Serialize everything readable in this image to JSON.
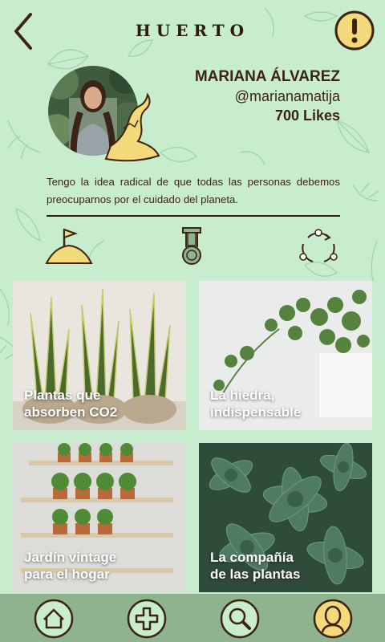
{
  "header": {
    "title": "HUERTO",
    "back_icon": "chevron-left-icon",
    "alert_icon": "exclamation-icon"
  },
  "profile": {
    "name": "MARIANA ÁLVAREZ",
    "handle": "@marianamatija",
    "likes": "700 Likes",
    "bio": "Tengo la idea radical de que todas las personas debemos preocuparnos por el cuidado del planeta."
  },
  "actions": [
    {
      "icon": "flag-mountain-icon"
    },
    {
      "icon": "medal-icon"
    },
    {
      "icon": "recycle-icon"
    }
  ],
  "cards": [
    {
      "label_1": "Plantas que",
      "label_2": "absorben CO2"
    },
    {
      "label_1": "La hiedra,",
      "label_2": "indispensable"
    },
    {
      "label_1": "Jardín vintage",
      "label_2": "para el hogar"
    },
    {
      "label_1": "La compañía",
      "label_2": "de las plantas"
    }
  ],
  "nav": [
    {
      "icon": "home-icon"
    },
    {
      "icon": "plus-icon"
    },
    {
      "icon": "search-icon"
    },
    {
      "icon": "profile-icon"
    }
  ],
  "colors": {
    "background": "#c8ecce",
    "accent": "#f3d97a",
    "text": "#3b2410",
    "bottom_bar": "#8fb28f"
  }
}
